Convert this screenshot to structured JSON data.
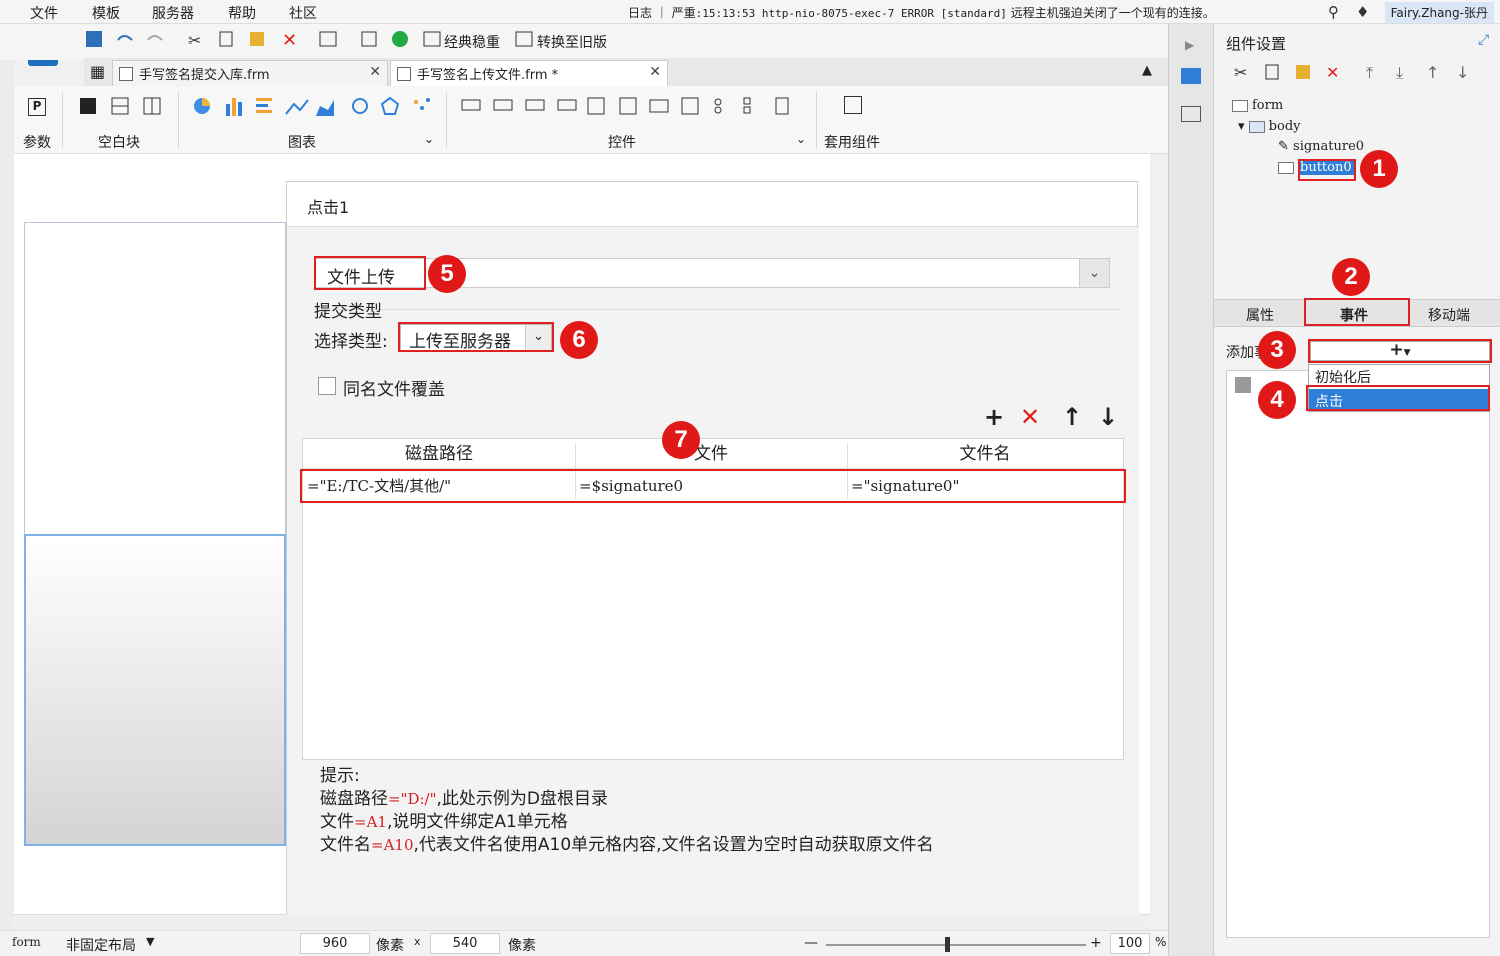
{
  "menu": [
    "文件",
    "模板",
    "服务器",
    "帮助",
    "社区"
  ],
  "status": {
    "prefix": "日志 ｜ 严重",
    "detail": ":15:13:53 http-nio-8075-exec-7 ERROR [standard]",
    "message": "远程主机强迫关闭了一个现有的连接。",
    "user": "Fairy.Zhang-张丹"
  },
  "toolbar": {
    "classic": "经典稳重",
    "convert": "转换至旧版"
  },
  "tabs": [
    {
      "label": "手写签名提交入库.frm"
    },
    {
      "label": "手写签名上传文件.frm *"
    }
  ],
  "ribbon": {
    "groups": [
      "参数",
      "空白块",
      "图表",
      "控件",
      "套用组件"
    ]
  },
  "dialog": {
    "title": "点击1",
    "action": "文件上传",
    "submit_type_label": "提交类型",
    "select_type_label": "选择类型:",
    "select_type_value": "上传至服务器",
    "overwrite_label": "同名文件覆盖",
    "columns": [
      "磁盘路径",
      "文件",
      "文件名"
    ],
    "rows": [
      [
        "=\"E:/TC-文档/其他/\"",
        "=$signature0",
        "=\"signature0\""
      ]
    ],
    "hint": {
      "title": "提示:",
      "l1a": "磁盘路径",
      "l1b": "=\"D:/\"",
      "l1c": ",此处示例为D盘根目录",
      "l2a": "文件",
      "l2b": "=A1",
      "l2c": ",说明文件绑定A1单元格",
      "l3a": "文件名",
      "l3b": "=A10",
      "l3c": ",代表文件名使用A10单元格内容,文件名设置为空时自动获取原文件名"
    }
  },
  "statusbar": {
    "mode": "form",
    "layout": "非固定布局",
    "width": "960",
    "unit1": "像素",
    "x": "x",
    "height": "540",
    "unit2": "像素",
    "minus": "—",
    "plus": "+",
    "zoom": "100",
    "percent": "%"
  },
  "right_panel": {
    "title": "组件设置",
    "tree": [
      "form",
      "body",
      "signature0",
      "button0"
    ],
    "tabs": [
      "属性",
      "事件",
      "移动端"
    ],
    "add_label": "添加事",
    "add_symbol": "+",
    "events": [
      "初始化后",
      "点击"
    ]
  },
  "badges": [
    "1",
    "2",
    "3",
    "4",
    "5",
    "6",
    "7"
  ],
  "colors": {
    "accent_red": "#e02020",
    "select_blue": "#2f7fd8"
  }
}
